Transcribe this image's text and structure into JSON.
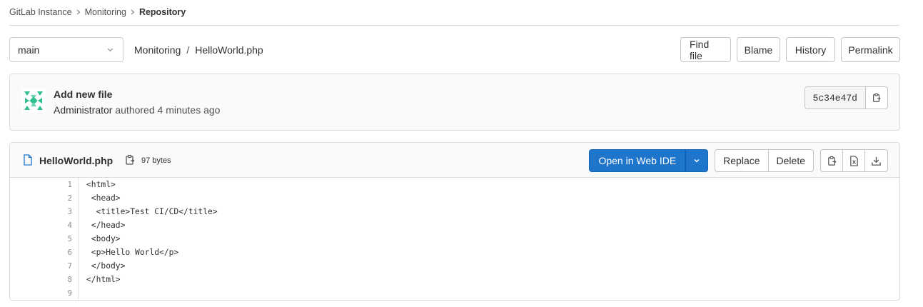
{
  "breadcrumbs": [
    "GitLab Instance",
    "Monitoring",
    "Repository"
  ],
  "ref": {
    "selected": "main"
  },
  "path": {
    "project": "Monitoring",
    "separator": "/",
    "file": "HelloWorld.php"
  },
  "tree_actions": {
    "find_file": "Find file",
    "blame": "Blame",
    "history": "History",
    "permalink": "Permalink"
  },
  "commit": {
    "title": "Add new file",
    "author": "Administrator",
    "authored_text": "authored 4 minutes ago",
    "sha": "5c34e47d",
    "avatar_colors": [
      "#2fbf8d",
      "#6fd3ae"
    ]
  },
  "file": {
    "name": "HelloWorld.php",
    "size": "97 bytes",
    "open_ide": "Open in Web IDE",
    "replace": "Replace",
    "delete": "Delete",
    "lines": [
      {
        "n": "1",
        "text": "<html>"
      },
      {
        "n": "2",
        "text": " <head>"
      },
      {
        "n": "3",
        "text": "  <title>Test CI/CD</title>"
      },
      {
        "n": "4",
        "text": " </head>"
      },
      {
        "n": "5",
        "text": " <body>"
      },
      {
        "n": "6",
        "text": " <p>Hello World</p>"
      },
      {
        "n": "7",
        "text": " </body>"
      },
      {
        "n": "8",
        "text": "</html>"
      },
      {
        "n": "9",
        "text": ""
      }
    ]
  },
  "icons": {
    "breadcrumb_separator": "chevron-right-icon",
    "ref_dropdown": "chevron-down-icon",
    "file_type": "file-icon",
    "copy": "copy-icon",
    "raw": "document-code-icon",
    "download": "download-icon"
  },
  "colors": {
    "primary": "#1f75cb",
    "border": "#dbdbdb",
    "muted": "#525252"
  }
}
